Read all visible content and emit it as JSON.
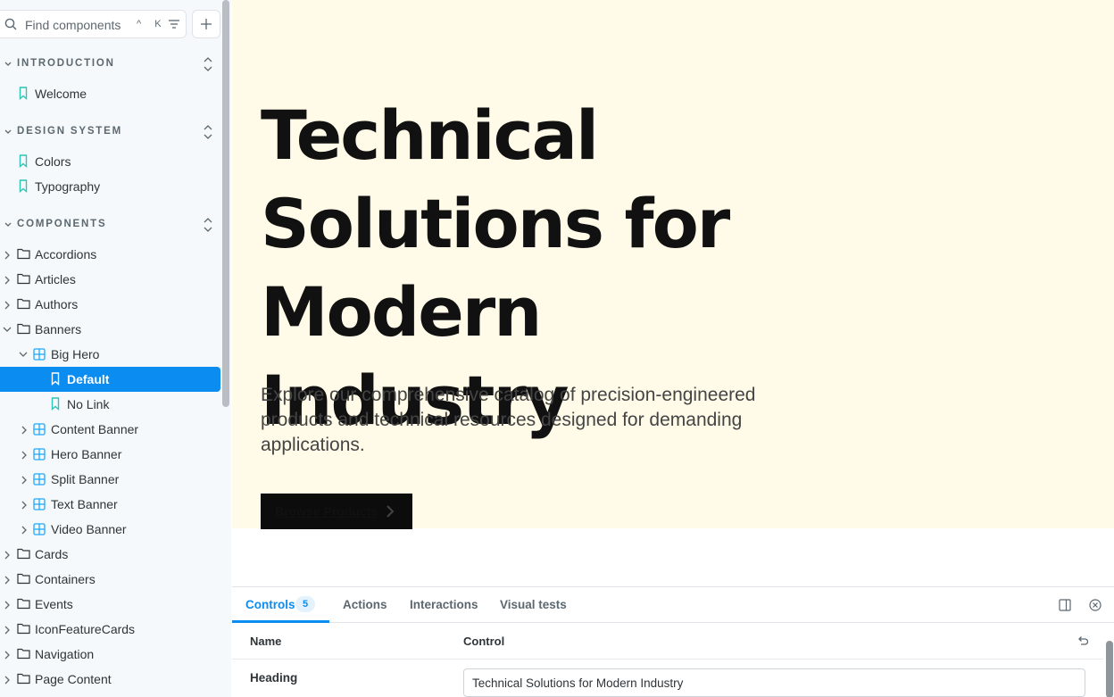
{
  "search": {
    "placeholder": "Find components",
    "shortcut": "^ K"
  },
  "sections": [
    {
      "label": "INTRODUCTION"
    },
    {
      "label": "DESIGN SYSTEM"
    },
    {
      "label": "COMPONENTS"
    }
  ],
  "intro_items": [
    "Welcome"
  ],
  "design_items": [
    "Colors",
    "Typography"
  ],
  "components": {
    "accordions": "Accordions",
    "articles": "Articles",
    "authors": "Authors",
    "banners": "Banners",
    "big_hero": "Big Hero",
    "default": "Default",
    "no_link": "No Link",
    "content_banner": "Content Banner",
    "hero_banner": "Hero Banner",
    "split_banner": "Split Banner",
    "text_banner": "Text Banner",
    "video_banner": "Video Banner",
    "cards": "Cards",
    "containers": "Containers",
    "events": "Events",
    "icon_feature_cards": "IconFeatureCards",
    "navigation": "Navigation",
    "page_content": "Page Content"
  },
  "hero": {
    "heading": "Technical Solutions for Modern Industry",
    "description": "Explore our comprehensive catalog of precision-engineered products and technical resources designed for demanding applications.",
    "cta_label": "Browse Products"
  },
  "panel": {
    "tabs": [
      {
        "label": "Controls",
        "count": "5"
      },
      {
        "label": "Actions"
      },
      {
        "label": "Interactions"
      },
      {
        "label": "Visual tests"
      }
    ],
    "columns": {
      "name": "Name",
      "control": "Control"
    },
    "rows": [
      {
        "name": "Heading",
        "value": "Technical Solutions for Modern Industry"
      }
    ]
  },
  "colors": {
    "accent": "#0b8cf0",
    "story_icon": "#2ec4b6",
    "component_icon": "#1ea7fd",
    "hero_bg": "#fffbe8"
  }
}
